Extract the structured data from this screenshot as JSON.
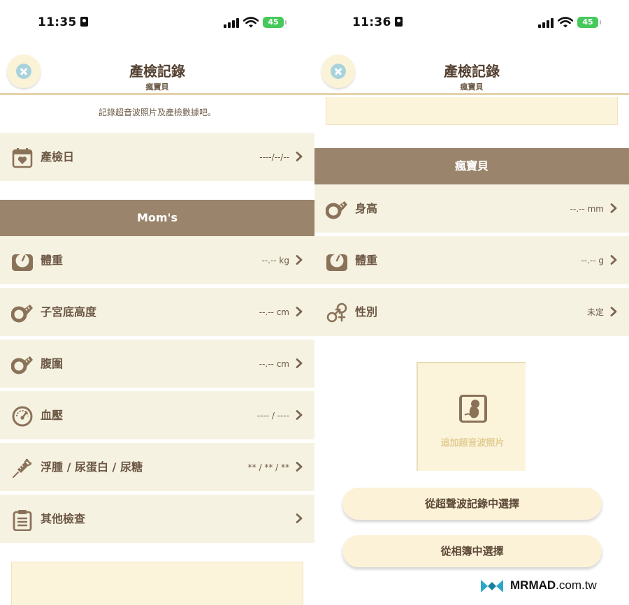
{
  "left_screen": {
    "status": {
      "time": "11:35",
      "battery": "45"
    },
    "nav": {
      "title": "產檢記錄",
      "subtitle": "瘋寶貝"
    },
    "hint": "記錄超音波照片及產檢數據吧。",
    "exam_date": {
      "label": "產檢日",
      "value": "----/--/--",
      "icon": "calendar-heart-icon"
    },
    "mom_section": {
      "header": "Mom's",
      "rows": [
        {
          "label": "體重",
          "value": "--.-- kg",
          "icon": "scale-icon"
        },
        {
          "label": "子宮底高度",
          "value": "--.-- cm",
          "icon": "tape-measure-icon"
        },
        {
          "label": "腹圍",
          "value": "--.-- cm",
          "icon": "tape-measure-icon"
        },
        {
          "label": "血壓",
          "value": "---- / ----",
          "icon": "gauge-icon"
        },
        {
          "label": "浮腫 / 尿蛋白 / 尿糖",
          "value": "** / ** / **",
          "icon": "syringe-icon"
        },
        {
          "label": "其他檢查",
          "value": "",
          "icon": "clipboard-icon"
        }
      ]
    }
  },
  "right_screen": {
    "status": {
      "time": "11:36",
      "battery": "45"
    },
    "nav": {
      "title": "產檢記錄",
      "subtitle": "瘋寶貝"
    },
    "baby_section": {
      "header": "瘋寶貝",
      "rows": [
        {
          "label": "身高",
          "value": "--.-- mm",
          "icon": "tape-measure-icon"
        },
        {
          "label": "體重",
          "value": "--.-- g",
          "icon": "scale-icon"
        },
        {
          "label": "性別",
          "value": "未定",
          "icon": "gender-icon"
        }
      ]
    },
    "photo": {
      "label": "追加超音波照片",
      "icon": "ultrasound-fetus-icon"
    },
    "buttons": {
      "from_ultrasound": "從超聲波記錄中選擇",
      "from_album": "從相簿中選擇"
    }
  },
  "watermark": {
    "brand": "MRMAD",
    "suffix": ".com.tw"
  },
  "colors": {
    "row_bg": "#f6f2e1",
    "section_header": "#9a846b",
    "accent_line": "#e3d3ad",
    "text": "#6b5744",
    "close_icon": "#a9d3dc",
    "battery": "#45c95a"
  }
}
